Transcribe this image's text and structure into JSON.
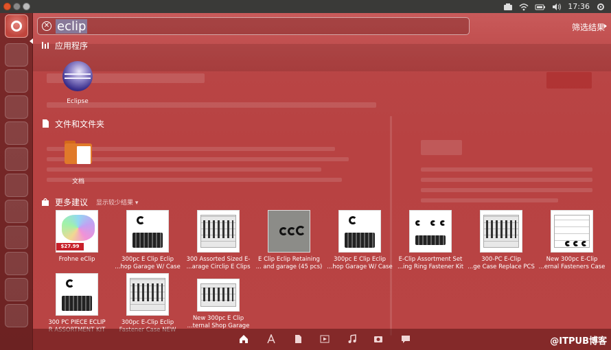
{
  "clock": "17:36",
  "search": {
    "query": "eclip",
    "filter_label": "筛选结果"
  },
  "sections": {
    "apps": {
      "title": "应用程序",
      "items": [
        {
          "label": "Eclipse",
          "icon": "eclipse-icon"
        }
      ]
    },
    "files": {
      "title": "文件和文件夹",
      "items": [
        {
          "label": "文档",
          "icon": "folder-icon"
        }
      ]
    },
    "more": {
      "title": "更多建议",
      "toggle": "显示较少结果",
      "items": [
        {
          "cap1": "Frohne eClip",
          "cap2": "",
          "price": "$27.99"
        },
        {
          "cap1": "300pc E Clip Eclip",
          "cap2": "...hop Garage W/ Case"
        },
        {
          "cap1": "300 Assorted Sized E-",
          "cap2": "...arage Circlip E Clips"
        },
        {
          "cap1": "E Clip Eclip Retaining",
          "cap2": "... and garage (45 pcs)"
        },
        {
          "cap1": "300pc E Clip Eclip",
          "cap2": "...hop Garage W/ Case"
        },
        {
          "cap1": "E-Clip Assortment Set",
          "cap2": "...ing Ring Fastener Kit"
        },
        {
          "cap1": "300-PC E-Clip",
          "cap2": "...ge Case Replace PCS"
        },
        {
          "cap1": "New 300pc E-Clip",
          "cap2": "...ernal Fasteners Case"
        },
        {
          "cap1": "300 PC PIECE ECLIP",
          "cap2": "R ASSORTMENT KIT"
        },
        {
          "cap1": "300pc E-Clip Eclip",
          "cap2": "Fastener Case NEW"
        },
        {
          "cap1": "New 300pc E Clip",
          "cap2": "...ternal Shop Garage"
        }
      ]
    }
  },
  "lenses": [
    "home-lens-icon",
    "apps-lens-icon",
    "files-lens-icon",
    "video-lens-icon",
    "music-lens-icon",
    "photo-lens-icon",
    "social-lens-icon"
  ],
  "watermark": "@ITPUB博客",
  "colors": {
    "dash_tint": "#b94444",
    "launcher": "#6c2222",
    "panel": "#3a3a38"
  }
}
